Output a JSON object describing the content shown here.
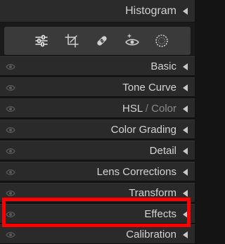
{
  "histogram": {
    "label": "Histogram"
  },
  "toolbar": {
    "tools": [
      "edit-sliders-icon",
      "crop-icon",
      "healing-icon",
      "masking-icon",
      "red-eye-icon"
    ]
  },
  "panels": [
    {
      "label": "Basic"
    },
    {
      "label": "Tone Curve"
    },
    {
      "hsl": "HSL",
      "sep": " / ",
      "color": "Color"
    },
    {
      "label": "Color Grading"
    },
    {
      "label": "Detail"
    },
    {
      "label": "Lens Corrections"
    },
    {
      "label": "Transform"
    },
    {
      "label": "Effects"
    },
    {
      "label": "Calibration"
    }
  ],
  "colors": {
    "highlight": "#ff0000",
    "panel_bg": "#2a2a2a",
    "text": "#d4d4d4"
  }
}
